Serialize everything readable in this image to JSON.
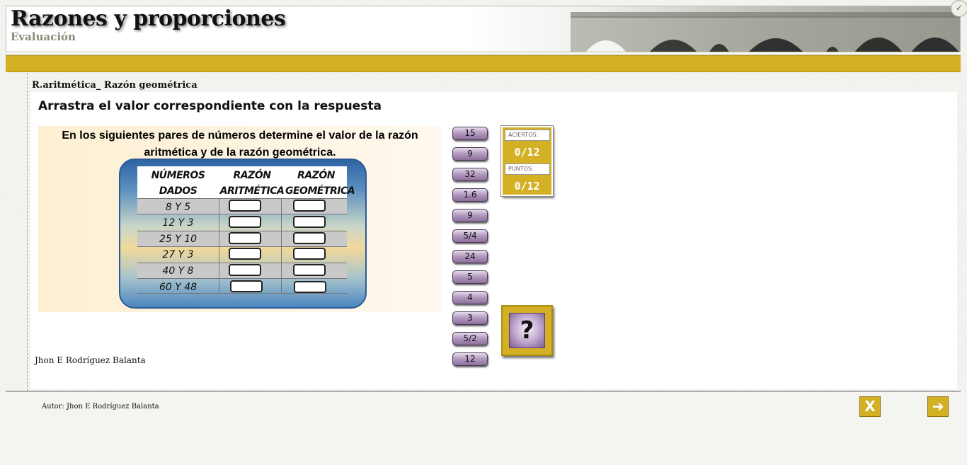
{
  "header": {
    "title": "Razones y proporciones",
    "subtitle": "Evaluación"
  },
  "section_title": "R.aritmética_ Razón geométrica",
  "instruction": "Arrastra el valor correspondiente con la respuesta",
  "exercise": {
    "question": "En los siguientes pares de números determine el valor de la razón aritmética y de la razón geométrica.",
    "headers": {
      "col1_line1": "NÚMEROS",
      "col1_line2": "DADOS",
      "col2_line1": "RAZÓN",
      "col2_line2": "ARITMÉTICA",
      "col3_line1": "RAZÓN",
      "col3_line2": "GEOMÉTRICA"
    },
    "rows": [
      "8 Y 5",
      "12 Y 3",
      "25 Y 10",
      "27 Y 3",
      "40 Y 8",
      "60 Y 48"
    ]
  },
  "tiles": [
    "15",
    "9",
    "32",
    "1.6",
    "9",
    "5/4",
    "24",
    "5",
    "4",
    "3",
    "5/2",
    "12"
  ],
  "score": {
    "aciertos_label": "ACIERTOS:",
    "aciertos_value": "0/12",
    "puntos_label": "PUNTOS:",
    "puntos_value": "0/12"
  },
  "help_symbol": "?",
  "author_inline": "Jhon E Rodríguez Balanta",
  "footer": {
    "author": "Autor: Jhon E Rodríguez Balanta",
    "close_symbol": "X",
    "next_symbol": "➔"
  },
  "corner_symbol": "✓",
  "colors": {
    "accent_gold": "#d4b024",
    "tile_purple": "#8d6f9c"
  }
}
